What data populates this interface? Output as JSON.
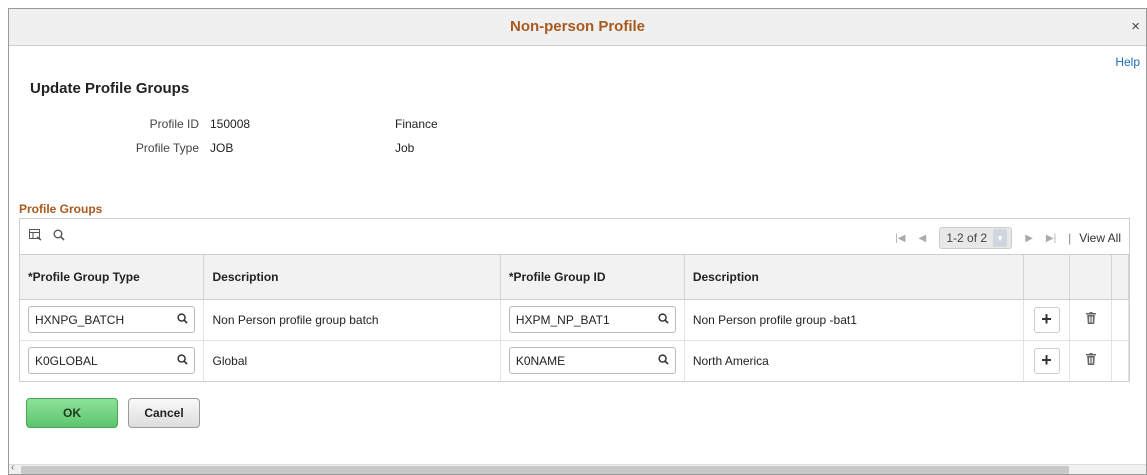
{
  "modal": {
    "title": "Non-person Profile",
    "close": "×",
    "help": "Help"
  },
  "page_title": "Update Profile Groups",
  "fields": {
    "profile_id_label": "Profile ID",
    "profile_id_value": "150008",
    "profile_id_desc": "Finance",
    "profile_type_label": "Profile Type",
    "profile_type_value": "JOB",
    "profile_type_desc": "Job"
  },
  "section": {
    "title": "Profile Groups"
  },
  "grid": {
    "pager": {
      "first": "|◀",
      "prev": "◀",
      "count": "1-2 of 2",
      "next": "▶",
      "last": "▶|",
      "view_all": "View All",
      "sep": "|"
    },
    "columns": [
      "*Profile Group Type",
      "Description",
      "*Profile Group ID",
      "Description"
    ],
    "rows": [
      {
        "type": "HXNPG_BATCH",
        "type_desc": "Non Person profile group batch",
        "group_id": "HXPM_NP_BAT1",
        "group_desc": "Non Person profile group -bat1"
      },
      {
        "type": "K0GLOBAL",
        "type_desc": "Global",
        "group_id": "K0NAME",
        "group_desc": "North America"
      }
    ]
  },
  "buttons": {
    "ok": "OK",
    "cancel": "Cancel"
  },
  "icons": {
    "search": "search-icon",
    "grid_personalize": "grid-settings-icon",
    "add": "plus-icon",
    "delete": "trash-icon"
  },
  "colors": {
    "title_orange": "#a8591e",
    "link_blue": "#1d6bb5",
    "ok_green": "#5cc56d"
  }
}
